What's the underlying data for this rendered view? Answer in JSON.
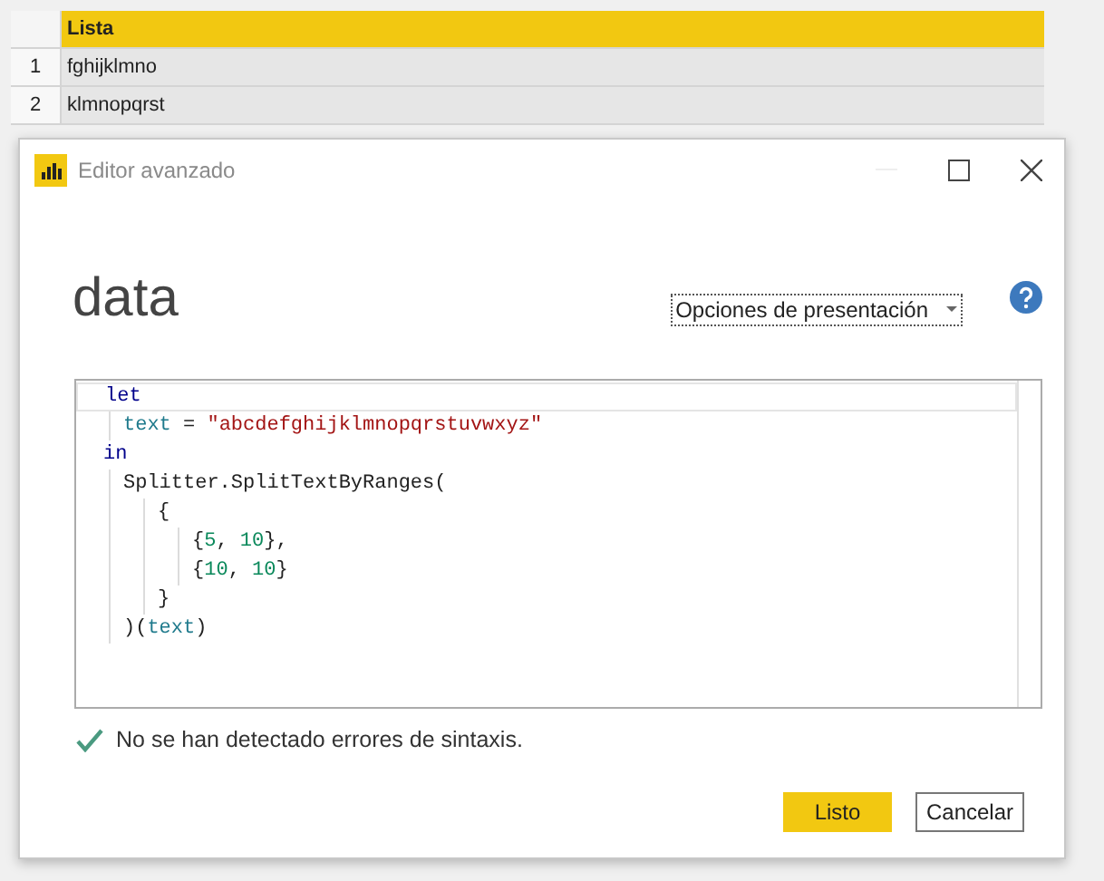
{
  "table": {
    "columns": [
      "Lista"
    ],
    "rows": [
      {
        "index": "1",
        "cells": [
          "fghijklmno"
        ]
      },
      {
        "index": "2",
        "cells": [
          "klmnopqrst"
        ]
      }
    ]
  },
  "dialog": {
    "title": "Editor avanzado",
    "query_name": "data",
    "display_options": "Opciones de presentación",
    "code": [
      {
        "current": true,
        "tokens": [
          {
            "kind": "keyword",
            "text": "let"
          }
        ],
        "children": [
          {
            "current": false,
            "tokens": [
              {
                "kind": "identifier",
                "text": "text"
              },
              {
                "kind": "plain",
                "text": " = "
              },
              {
                "kind": "string",
                "text": "\"abcdefghijklmnopqrstuvwxyz\""
              }
            ]
          }
        ]
      },
      {
        "current": false,
        "tokens": [
          {
            "kind": "keyword",
            "text": "in"
          }
        ],
        "children": [
          {
            "current": false,
            "tokens": [
              {
                "kind": "plain",
                "text": "Splitter.SplitTextByRanges("
              }
            ],
            "children": [
              {
                "current": false,
                "tokens": [
                  {
                    "kind": "plain",
                    "text": "{"
                  }
                ],
                "children": [
                  {
                    "current": false,
                    "tokens": [
                      {
                        "kind": "plain",
                        "text": "{"
                      },
                      {
                        "kind": "number",
                        "text": "5"
                      },
                      {
                        "kind": "plain",
                        "text": ", "
                      },
                      {
                        "kind": "number",
                        "text": "10"
                      },
                      {
                        "kind": "plain",
                        "text": "},"
                      }
                    ]
                  },
                  {
                    "current": false,
                    "tokens": [
                      {
                        "kind": "plain",
                        "text": "{"
                      },
                      {
                        "kind": "number",
                        "text": "10"
                      },
                      {
                        "kind": "plain",
                        "text": ", "
                      },
                      {
                        "kind": "number",
                        "text": "10"
                      },
                      {
                        "kind": "plain",
                        "text": "}"
                      }
                    ]
                  }
                ]
              },
              {
                "current": false,
                "tokens": [
                  {
                    "kind": "plain",
                    "text": "}"
                  }
                ]
              }
            ]
          },
          {
            "current": false,
            "tokens": [
              {
                "kind": "plain",
                "text": ")("
              },
              {
                "kind": "identifier",
                "text": "text"
              },
              {
                "kind": "plain",
                "text": ")"
              }
            ]
          }
        ]
      }
    ],
    "status": {
      "kind": "success",
      "text": "No se han detectado errores de sintaxis."
    },
    "buttons": [
      {
        "kind": "primary",
        "label": "Listo"
      },
      {
        "kind": "secondary",
        "label": "Cancelar"
      }
    ]
  }
}
